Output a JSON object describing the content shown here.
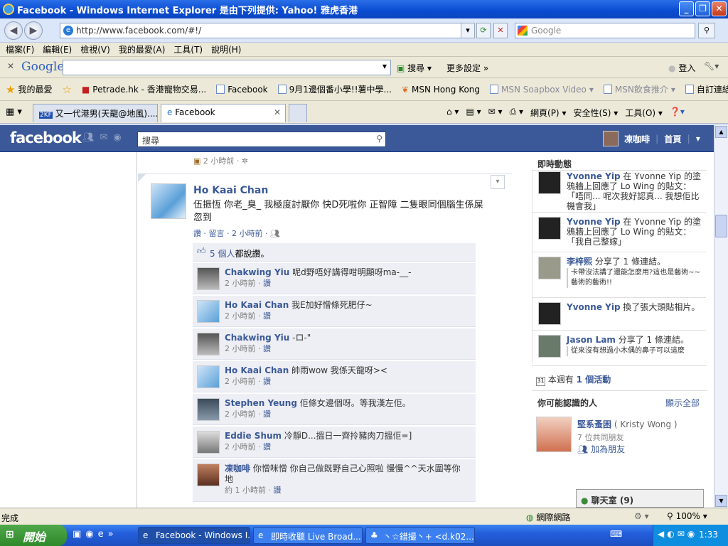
{
  "window": {
    "title": "Facebook - Windows Internet Explorer 是由下列提供: Yahoo! 雅虎香港"
  },
  "address_bar": {
    "url": "http://www.facebook.com/#!/",
    "search_placeholder": "Google"
  },
  "menu": [
    "檔案(F)",
    "編輯(E)",
    "檢視(V)",
    "我的最愛(A)",
    "工具(T)",
    "說明(H)"
  ],
  "google_toolbar": {
    "logo": "Google",
    "search_label": "搜尋",
    "more_label": "更多設定 »",
    "login_label": "登入"
  },
  "favorites": {
    "label": "我的最愛",
    "items": [
      "Petrade.hk - 香港寵物交易...",
      "Facebook",
      "9月1邊個番小學!!薯中學...",
      "MSN Hong Kong",
      "MSN Soapbox Video",
      "MSN飲食推介",
      "自訂連結"
    ]
  },
  "tabs": [
    {
      "label": "又一代港男(天龍@地風)........"
    },
    {
      "label": "Facebook"
    }
  ],
  "ie_commands": {
    "page": "網頁(P)",
    "safety": "安全性(S)",
    "tools": "工具(O)"
  },
  "fb_header": {
    "logo": "facebook",
    "search_placeholder": "搜尋",
    "user_name": "凍咖啡",
    "home_label": "首頁"
  },
  "feed": {
    "prev_time": "2 小時前 · ",
    "post": {
      "author": "Ho Kaai Chan",
      "text": "伍振恆 你老_臭_ 我極度討厭你 快D死啦你 正智障 二隻眼同個腦生係屎忽到",
      "actions": "讚 · 留言 · 2 小時前 · ",
      "likes_count": "5 個人",
      "likes_text": "都說讚。"
    },
    "comments": [
      {
        "name": "Chakwing Yiu",
        "text": "呢d野唔好講得咁明顯呀ma-__-",
        "time": "2 小時前 · ",
        "like": "讚"
      },
      {
        "name": "Ho Kaai Chan",
        "text": "我E加好憎條死肥仔~",
        "time": "2 小時前 · ",
        "like": "讚"
      },
      {
        "name": "Chakwing Yiu",
        "text": "-ロ-\"",
        "time": "2 小時前 · ",
        "like": "讚"
      },
      {
        "name": "Ho Kaai Chan",
        "text": "帥雨wow 我係天龍呀><",
        "time": "2 小時前 · ",
        "like": "讚"
      },
      {
        "name": "Stephen Yeung",
        "text": "佢條女邊個呀。等我漢左佢。",
        "time": "2 小時前 · ",
        "like": "讚"
      },
      {
        "name": "Eddie Shum",
        "text": "冷靜D...搵日一齊拎豬肉刀搵佢=]",
        "time": "2 小時前 · ",
        "like": "讚"
      },
      {
        "name": "凍咖啡",
        "text": "你憎咪憎  你自己做既野自己心照啦 慢慢^^天水圍等你地",
        "time": "約 1 小時前 · ",
        "like": "讚"
      }
    ]
  },
  "ticker": {
    "title": "即時動態",
    "items": [
      {
        "name": "Yvonne Yip",
        "text": " 在 Yvonne Yip 的塗鴉牆上回應了 Lo Wing 的貼文：「唔同... 呢次我好認真... 我想佢比機會我」"
      },
      {
        "name": "Yvonne Yip",
        "text": " 在 Yvonne Yip 的塗鴉牆上回應了 Lo Wing 的貼文：「我自己整嫁」"
      },
      {
        "name": "李梓熙",
        "text": " 分享了 1 條連結。",
        "sub": "卡帶沒法講了還能怎麼用?這也是藝術~~藝術的藝術!!"
      },
      {
        "name": "Yvonne Yip",
        "text": " 換了張大頭貼相片。"
      },
      {
        "name": "Jason Lam",
        "text": " 分享了 1 條連結。",
        "sub": "從來沒有想過小木偶的鼻子可以這麼"
      }
    ]
  },
  "events": {
    "prefix": "本週有",
    "link": "1 個活動"
  },
  "pymk": {
    "title": "你可能認識的人",
    "show_all": "顯示全部",
    "name": "堅系蚤困",
    "alias": "( Kristy Wong )",
    "mutual": "7 位共同朋友",
    "add": "加為朋友"
  },
  "chat": {
    "label": "聊天室 (9)"
  },
  "status": {
    "left": "完成",
    "zone": "網際網路",
    "zoom": "100%"
  },
  "taskbar": {
    "start": "開始",
    "buttons": [
      "Facebook - Windows I...",
      "即時收聽 Live Broad...",
      "丶☆錯撮丶+ <d.k02..."
    ],
    "clock": "1:33"
  }
}
